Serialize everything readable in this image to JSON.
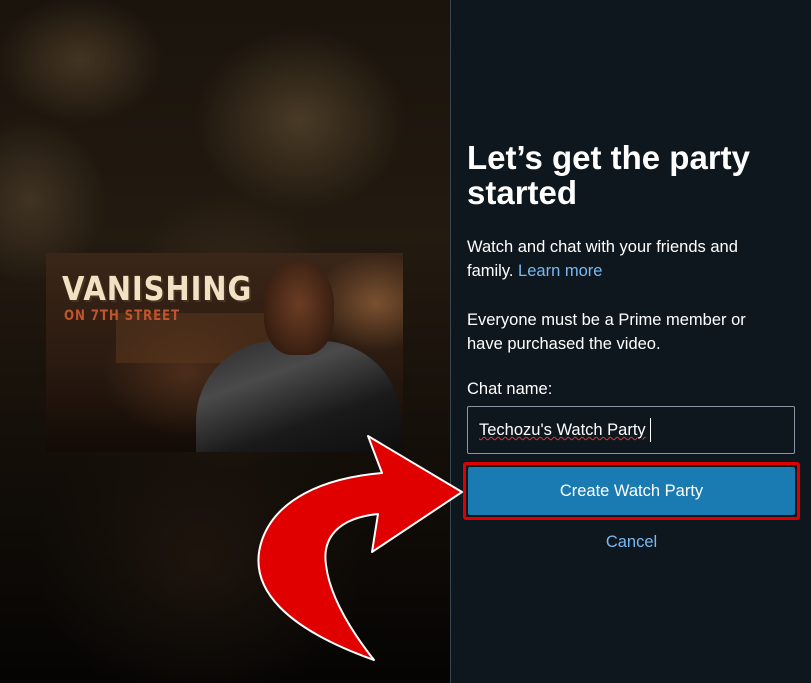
{
  "thumbnail": {
    "title": "VANISHING",
    "subtitle": "ON 7TH STREET"
  },
  "dialog": {
    "heading": "Let’s get the party started",
    "description": "Watch and chat with your friends and family.",
    "learn_more": "Learn more",
    "requirement": "Everyone must be a Prime member or have purchased the video.",
    "chat_name_label": "Chat name:",
    "chat_name_value": "Techozu's Watch Party",
    "create_button": "Create Watch Party",
    "cancel": "Cancel"
  },
  "colors": {
    "panel_bg": "#0f171e",
    "button_bg": "#1a7bb3",
    "link": "#79b8f3",
    "annotation_red": "#e00000"
  }
}
